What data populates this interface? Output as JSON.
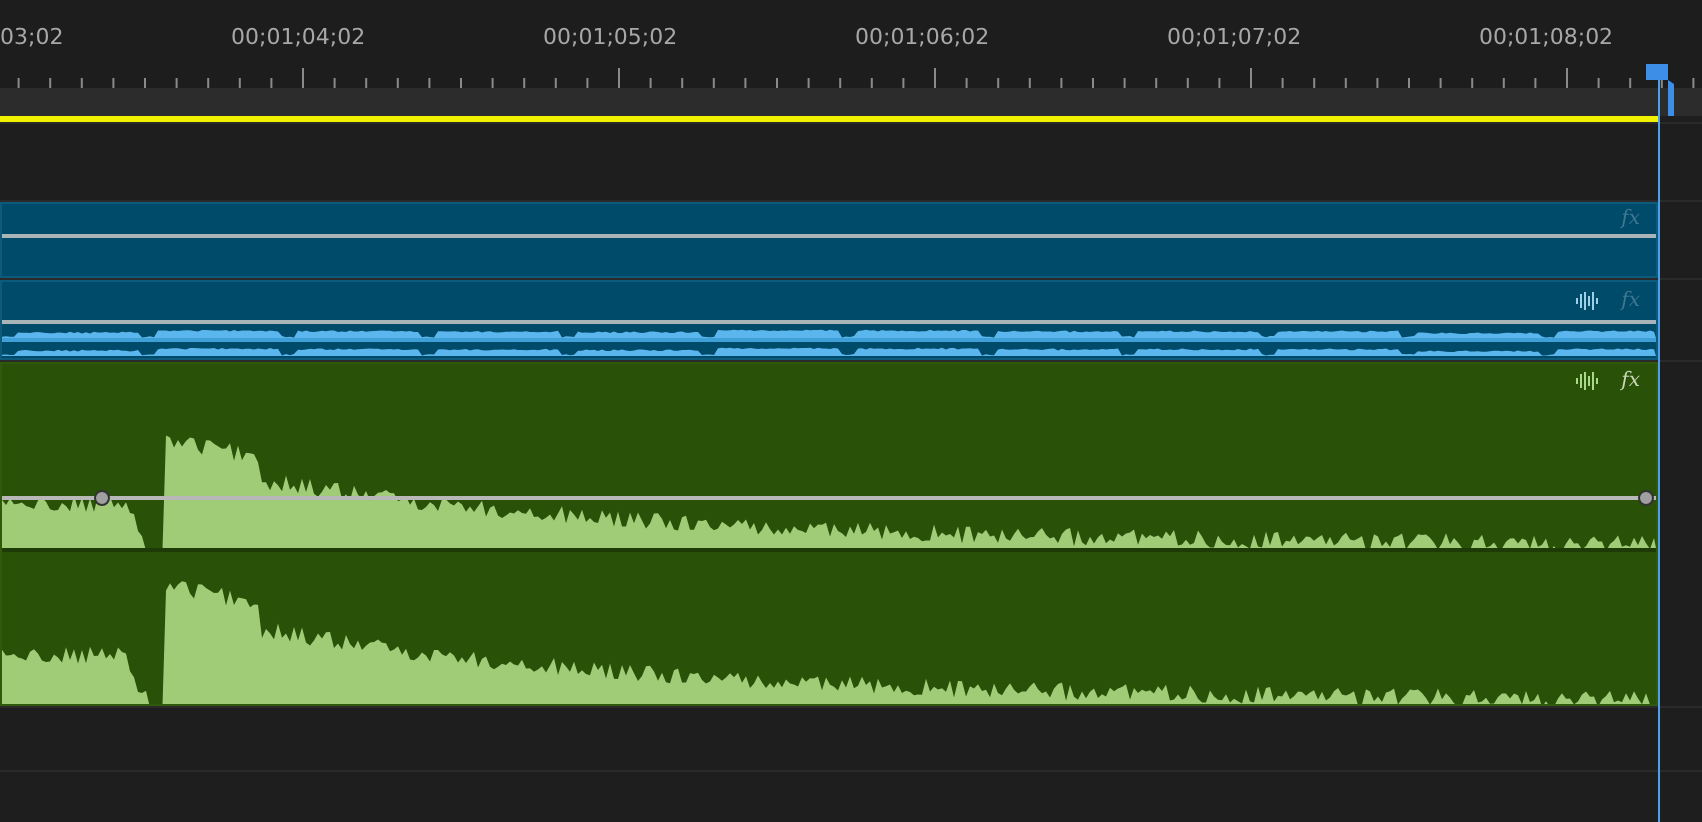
{
  "ruler": {
    "timecodes": [
      "03;02",
      "00;01;04;02",
      "00;01;05;02",
      "00;01;06;02",
      "00;01;07;02",
      "00;01;08;02"
    ]
  },
  "tracks": [
    {
      "kind": "empty"
    },
    {
      "kind": "clip",
      "clip": {
        "kind": "video",
        "fx": "fx"
      }
    },
    {
      "kind": "clip",
      "clip": {
        "kind": "linked-audio",
        "fx": "fx"
      }
    },
    {
      "kind": "clip",
      "clip": {
        "kind": "audio",
        "fx": "fx"
      }
    },
    {
      "kind": "empty"
    },
    {
      "kind": "empty"
    }
  ]
}
